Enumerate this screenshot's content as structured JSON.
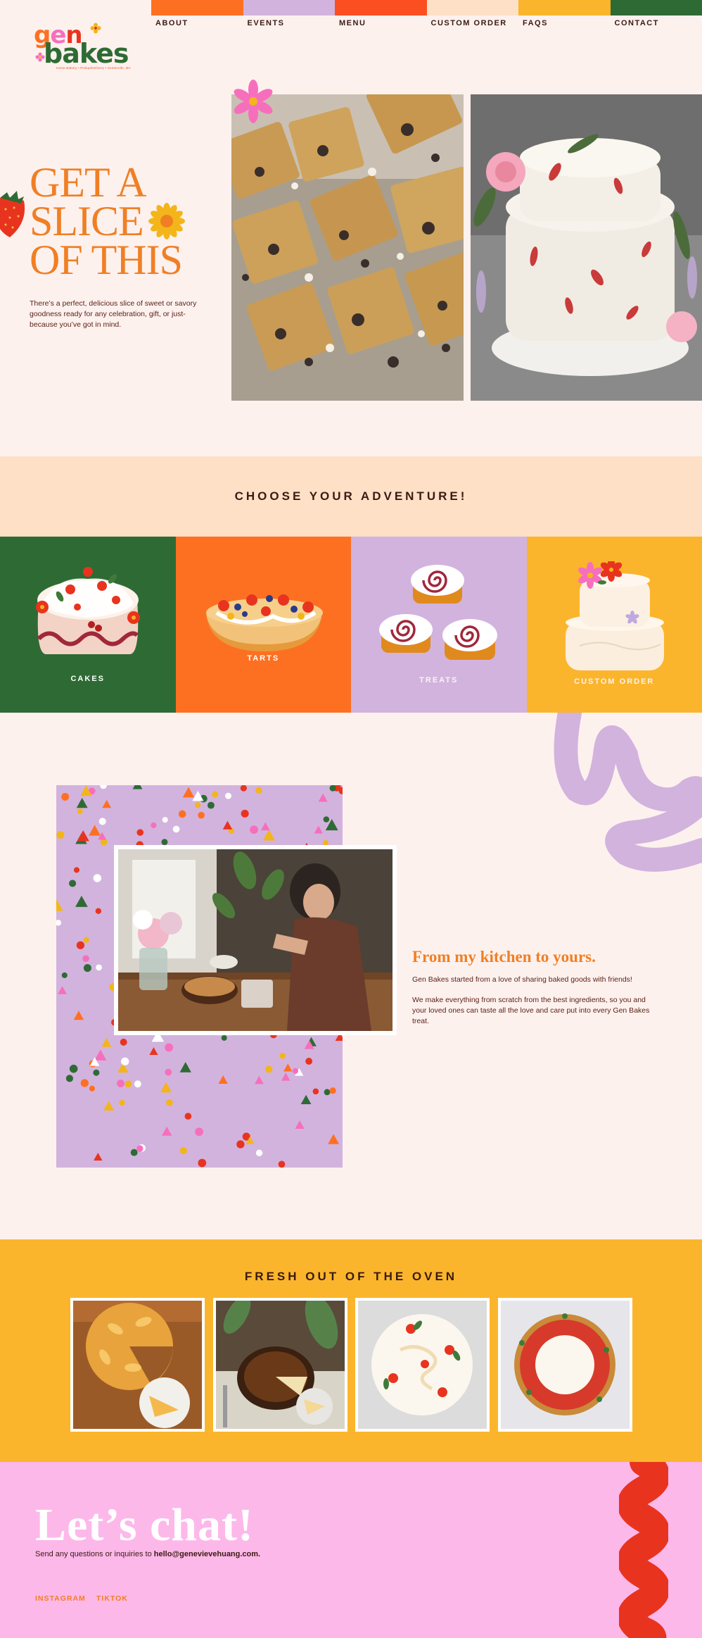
{
  "nav": {
    "items": [
      {
        "label": "ABOUT",
        "color": "#fd7022"
      },
      {
        "label": "EVENTS",
        "color": "#d2b3de"
      },
      {
        "label": "MENU",
        "color": "#fb4f22"
      },
      {
        "label": "CUSTOM ORDER",
        "color": "#fde0c6"
      },
      {
        "label": "FAQS",
        "color": "#fbb52c"
      },
      {
        "label": "CONTACT",
        "color": "#2e6b34"
      }
    ]
  },
  "logo": {
    "line1": "gen",
    "line2": "bakes",
    "tagline": "Home Bakery • Pickup/Delivery • Somerville, MA"
  },
  "hero": {
    "title_lines": [
      "GET A",
      "SLICE",
      "OF THIS"
    ],
    "text": "There’s a perfect, delicious slice of sweet or savory goodness ready for any celebration, gift, or just-because you’ve got in mind."
  },
  "adventure": {
    "title": "CHOOSE YOUR ADVENTURE!",
    "categories": [
      {
        "label": "CAKES",
        "color": "#2e6b34"
      },
      {
        "label": "TARTS",
        "color": "#fd7022"
      },
      {
        "label": "TREATS",
        "color": "#d2b3de"
      },
      {
        "label": "CUSTOM ORDER",
        "color": "#fbb52c"
      }
    ]
  },
  "kitchen": {
    "title": "From my kitchen to yours.",
    "p1": "Gen Bakes started from a love of sharing baked goods with friends!",
    "p2": "We make everything from scratch from the best ingredients, so you and your loved ones can taste all the love and care put into every Gen Bakes treat."
  },
  "oven": {
    "title": "FRESH OUT OF THE OVEN"
  },
  "chat": {
    "title": "Let’s chat!",
    "text_prefix": "Send any questions or inquiries to ",
    "email": "hello@genevievehuang.com.",
    "links": [
      "INSTAGRAM",
      "TIKTOK"
    ]
  },
  "colors": {
    "orange": "#f07f24",
    "cream": "#fdf1ee",
    "green": "#2e6b34",
    "lavender": "#d2b3de",
    "yellow": "#fbb52c",
    "pink": "#fdb8ea",
    "red": "#e8341f"
  }
}
